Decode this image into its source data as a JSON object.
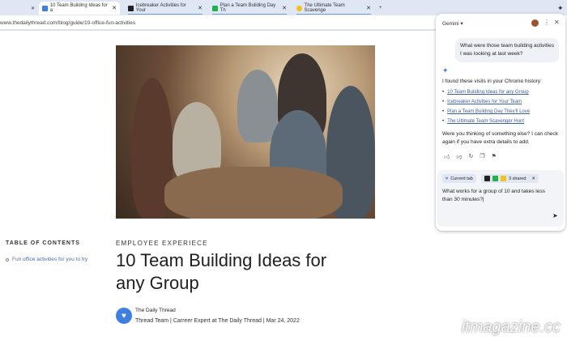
{
  "tabs": [
    {
      "label": "10 Team Building Ideas for a",
      "color": "#3f7fe0",
      "active": true
    },
    {
      "label": "Icebreaker Activities for Your",
      "color": "#222"
    },
    {
      "label": "Plan a Team Building Day Th",
      "color": "#1db34a"
    },
    {
      "label": "The Ultimate Team Scavenge",
      "color": "#f2c21b"
    }
  ],
  "address": "www.thedailythread.com/blog/guide/10-office-fun-activities",
  "toc": {
    "heading": "TABLE OF CONTENTS",
    "items": [
      "Fun office activities for you to try"
    ]
  },
  "article": {
    "category": "EMPLOYEE EXPERIECE",
    "title": "10 Team Building Ideas for any Group",
    "author_name": "The Daily Thread",
    "meta": "Thread Team | Carreer Expert at The Daily Thread | Mar 24, 2022"
  },
  "gemini": {
    "title": "Gemini ▾",
    "user_msg": "What were those team building activities I was looking at last week?",
    "intro": "I found these visits in your Chrome history:",
    "links": [
      "10 Team Building Ideas for any Group",
      "Icebreaker Activities for Your Team",
      "Plan a Team Building Day They'll Love",
      "The Ultimate Team Scavenger Hunt"
    ],
    "followup": "Were you thinking of something else? I can check again if you have extra details to add.",
    "chip_current": "Current tab",
    "chip_shared": "3 shared",
    "input_value": "What works for a group of 10 and takes less than 30 minutes?|"
  },
  "watermark": "itmagazine.cc"
}
